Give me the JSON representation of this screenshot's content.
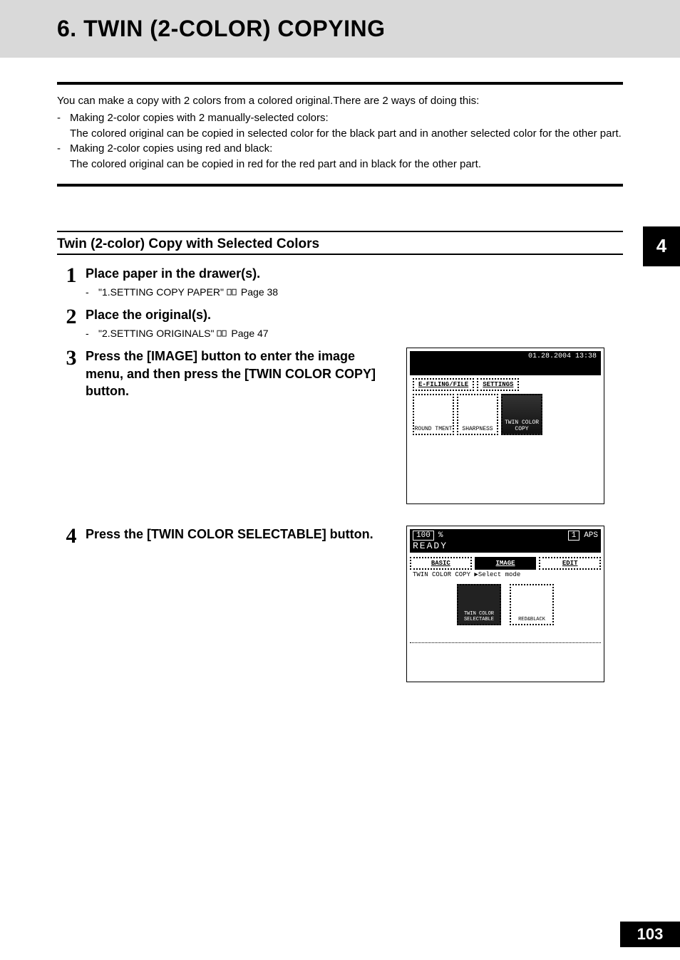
{
  "title": "6. TWIN (2-COLOR) COPYING",
  "intro": {
    "lead": "You can make a copy with 2 colors from a colored original.There are 2 ways of doing this:",
    "items": [
      {
        "head": "Making 2-color copies with 2 manually-selected colors:",
        "body": "The colored original can be copied in selected color for the black part and in another selected color for the other part."
      },
      {
        "head": "Making 2-color copies using red and black:",
        "body": "The colored original can be copied in red for the red part and in black for the other part."
      }
    ]
  },
  "chapter_tab": "4",
  "subheading": "Twin (2-color) Copy with Selected Colors",
  "steps": [
    {
      "num": "1",
      "main": "Place paper in the drawer(s).",
      "ref": {
        "text": "\"1.SETTING COPY PAPER\"",
        "page": "Page 38"
      }
    },
    {
      "num": "2",
      "main": "Place the original(s).",
      "ref": {
        "text": "\"2.SETTING ORIGINALS\"",
        "page": "Page 47"
      }
    },
    {
      "num": "3",
      "main": "Press the [IMAGE] button to enter the image menu, and then press the [TWIN COLOR COPY] button."
    },
    {
      "num": "4",
      "main": "Press the [TWIN COLOR SELECTABLE] button."
    }
  ],
  "screens": {
    "s1": {
      "datetime": "01.28.2004 13:38",
      "tab_a": "E-FILING/FILE",
      "tab_b": "SETTINGS",
      "btn1": "ROUND TMENT",
      "btn2": "SHARPNESS",
      "btn3": "TWIN COLOR COPY"
    },
    "s2": {
      "zoom": "100",
      "pct": "%",
      "copies": "1",
      "aps": "APS",
      "ready": "READY",
      "tab_basic": "BASIC",
      "tab_image": "IMAGE",
      "tab_edit": "EDIT",
      "crumb": "TWIN COLOR COPY  ▶Select mode",
      "btn_sel": "TWIN COLOR SELECTABLE",
      "btn_rb": "RED&BLACK"
    }
  },
  "page_number": "103"
}
